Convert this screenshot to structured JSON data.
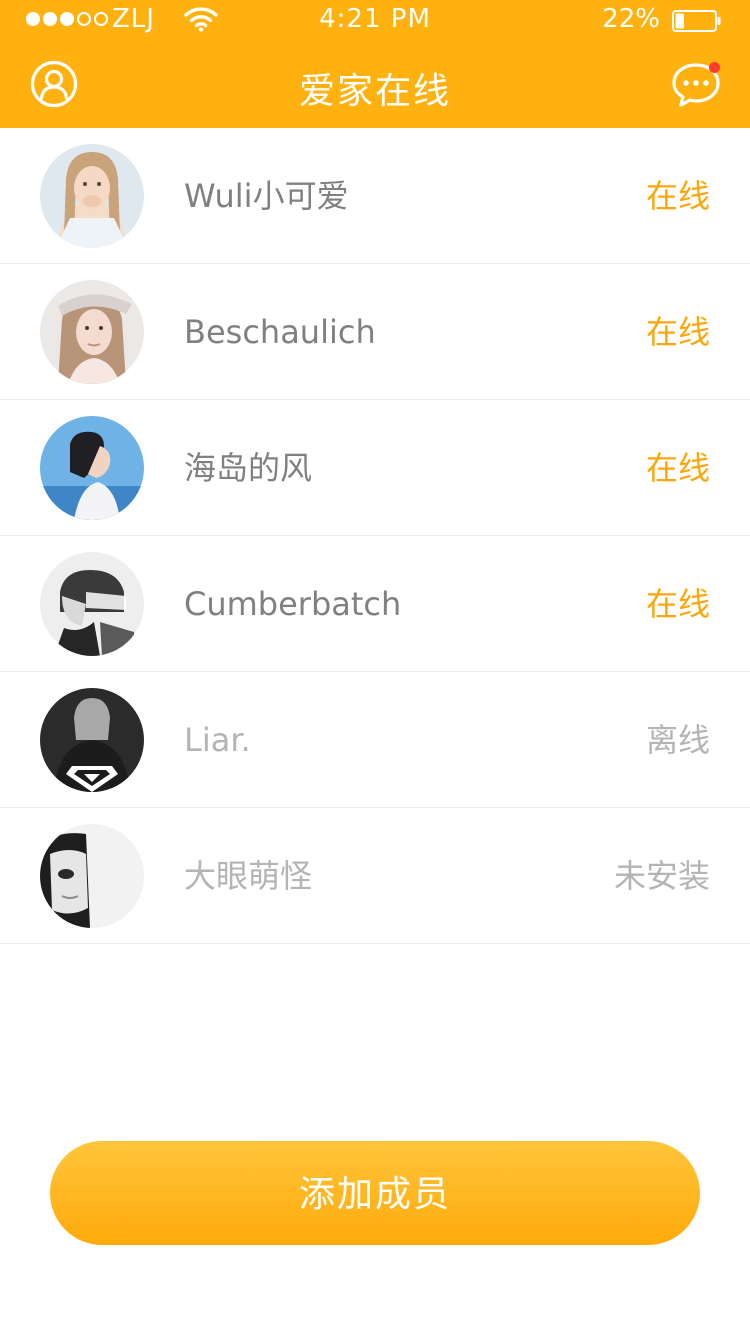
{
  "status_bar": {
    "signal_bars_filled": 3,
    "signal_bars_total": 5,
    "carrier": "ZLJ",
    "time": "4:21 PM",
    "battery_percent": "22%",
    "battery_level": 0.22
  },
  "nav": {
    "title": "爱家在线",
    "left_icon": "profile-icon",
    "right_icon": "message-bubble-icon",
    "right_icon_has_badge": true
  },
  "members": [
    {
      "name": "Wuli小可爱",
      "status": "在线",
      "active": true
    },
    {
      "name": "Beschaulich",
      "status": "在线",
      "active": true
    },
    {
      "name": "海岛的风",
      "status": "在线",
      "active": true
    },
    {
      "name": "Cumberbatch",
      "status": "在线",
      "active": true
    },
    {
      "name": "Liar.",
      "status": "离线",
      "active": false
    },
    {
      "name": "大眼萌怪",
      "status": "未安装",
      "active": false
    }
  ],
  "add_button_label": "添加成员",
  "colors": {
    "brand_orange": "#ffb10f",
    "online_status": "#ffa60a",
    "inactive_text": "#b4b4b4",
    "name_text": "#808080",
    "badge_red": "#ff3b30"
  }
}
